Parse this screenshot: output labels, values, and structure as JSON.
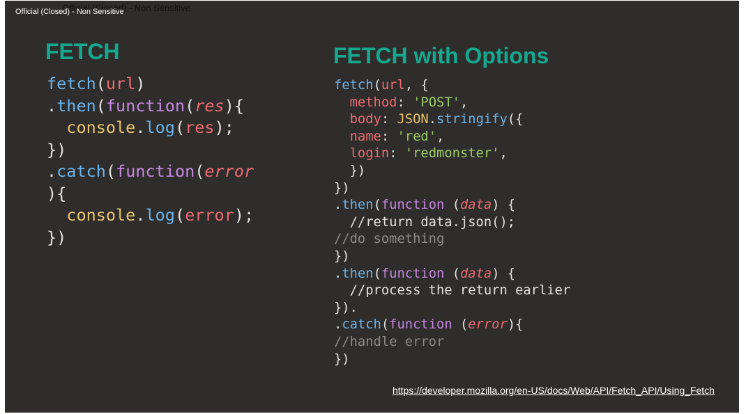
{
  "header": {
    "classification_front": "Official (Closed) - Non Sensitive",
    "classification_back": "Official (Closed) - Non Sensitive"
  },
  "left": {
    "title": "FETCH",
    "code_lines": [
      [
        [
          "fn",
          "fetch"
        ],
        [
          "pl",
          "("
        ],
        [
          "var",
          "url"
        ],
        [
          "pl",
          ")"
        ]
      ],
      [
        [
          "pl",
          "."
        ],
        [
          "fn",
          "then"
        ],
        [
          "pl",
          "("
        ],
        [
          "kw",
          "function"
        ],
        [
          "pl",
          "("
        ],
        [
          "it",
          "res"
        ],
        [
          "pl",
          "){"
        ]
      ],
      [
        [
          "pl",
          "  "
        ],
        [
          "obj",
          "console"
        ],
        [
          "pl",
          "."
        ],
        [
          "fn",
          "log"
        ],
        [
          "pl",
          "("
        ],
        [
          "var",
          "res"
        ],
        [
          "pl",
          ");"
        ]
      ],
      [
        [
          "pl",
          "})"
        ]
      ],
      [
        [
          "pl",
          "."
        ],
        [
          "fn",
          "catch"
        ],
        [
          "pl",
          "("
        ],
        [
          "kw",
          "function"
        ],
        [
          "pl",
          "("
        ],
        [
          "it",
          "error"
        ]
      ],
      [
        [
          "pl",
          "){"
        ]
      ],
      [
        [
          "pl",
          "  "
        ],
        [
          "obj",
          "console"
        ],
        [
          "pl",
          "."
        ],
        [
          "fn",
          "log"
        ],
        [
          "pl",
          "("
        ],
        [
          "var",
          "error"
        ],
        [
          "pl",
          ");"
        ]
      ],
      [
        [
          "pl",
          "})"
        ]
      ]
    ]
  },
  "right": {
    "title": "FETCH with Options",
    "code_lines": [
      [
        [
          "fn",
          "fetch"
        ],
        [
          "pl",
          "("
        ],
        [
          "var",
          "url"
        ],
        [
          "pl",
          ", {"
        ]
      ],
      [
        [
          "pl",
          "  "
        ],
        [
          "var",
          "method"
        ],
        [
          "pl",
          ": "
        ],
        [
          "str",
          "'POST'"
        ],
        [
          "pl",
          ","
        ]
      ],
      [
        [
          "pl",
          "  "
        ],
        [
          "var",
          "body"
        ],
        [
          "pl",
          ": "
        ],
        [
          "obj",
          "JSON"
        ],
        [
          "pl",
          "."
        ],
        [
          "fn",
          "stringify"
        ],
        [
          "pl",
          "({"
        ]
      ],
      [
        [
          "pl",
          "  "
        ],
        [
          "var",
          "name"
        ],
        [
          "pl",
          ": "
        ],
        [
          "str",
          "'red'"
        ],
        [
          "pl",
          ","
        ]
      ],
      [
        [
          "pl",
          "  "
        ],
        [
          "var",
          "login"
        ],
        [
          "pl",
          ": "
        ],
        [
          "str",
          "'redmonster'"
        ],
        [
          "pl",
          ","
        ]
      ],
      [
        [
          "pl",
          "  })"
        ]
      ],
      [
        [
          "pl",
          "})"
        ]
      ],
      [
        [
          "pl",
          "."
        ],
        [
          "fn",
          "then"
        ],
        [
          "pl",
          "("
        ],
        [
          "kw",
          "function"
        ],
        [
          "pl",
          " ("
        ],
        [
          "it",
          "data"
        ],
        [
          "pl",
          ") {"
        ]
      ],
      [
        [
          "pl",
          "  //return data.json();"
        ]
      ],
      [
        [
          "cm",
          "//do something"
        ]
      ],
      [
        [
          "pl",
          "})"
        ]
      ],
      [
        [
          "pl",
          "."
        ],
        [
          "fn",
          "then"
        ],
        [
          "pl",
          "("
        ],
        [
          "kw",
          "function"
        ],
        [
          "pl",
          " ("
        ],
        [
          "it",
          "data"
        ],
        [
          "pl",
          ") {"
        ]
      ],
      [
        [
          "pl",
          "  //process the return earlier"
        ]
      ],
      [
        [
          "pl",
          "})."
        ]
      ],
      [
        [
          "pl",
          "."
        ],
        [
          "fn",
          "catch"
        ],
        [
          "pl",
          "("
        ],
        [
          "kw",
          "function"
        ],
        [
          "pl",
          " ("
        ],
        [
          "it",
          "error"
        ],
        [
          "pl",
          "){"
        ]
      ],
      [
        [
          "cm",
          "//handle error"
        ]
      ],
      [
        [
          "pl",
          "})"
        ]
      ]
    ]
  },
  "footer": {
    "link_text": "https://developer.mozilla.org/en-US/docs/Web/API/Fetch_API/Using_Fetch"
  },
  "colors": {
    "slide_background": "#2f2d2b",
    "title": "#14a98e",
    "function_name": "#6ab3ea",
    "keyword": "#c587e0",
    "variable": "#ef6b73",
    "object": "#e9c46b",
    "string": "#9ccc65",
    "comment": "#8a8a8a",
    "plain": "#e2e2e2"
  }
}
